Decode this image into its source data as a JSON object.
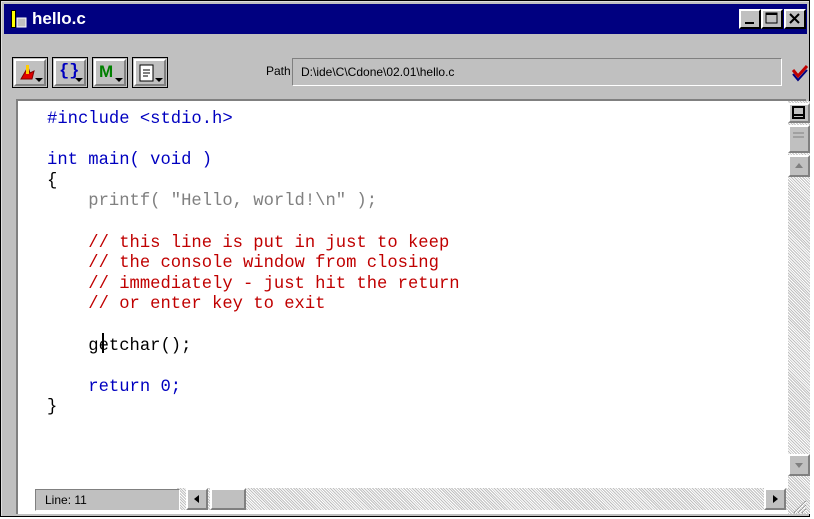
{
  "window": {
    "title": "hello.c"
  },
  "toolbar": {
    "buttons": [
      {
        "icon": "tools-icon",
        "label": ""
      },
      {
        "icon": "braces-icon",
        "label": "{}"
      },
      {
        "icon": "macro-icon",
        "label": "M"
      },
      {
        "icon": "document-icon",
        "label": ""
      }
    ],
    "path_label": "Path",
    "path_value": "D:\\ide\\C\\Cdone\\02.01\\hello.c"
  },
  "editor": {
    "lines": [
      "#include <stdio.h>",
      "",
      "int main( void )",
      "{",
      "    printf( \"Hello, world!\\n\" );",
      "",
      "    // this line is put in just to keep",
      "    // the console window from closing",
      "    // immediately - just hit the return",
      "    // or enter key to exit",
      "",
      "    getchar();",
      "",
      "    return 0;",
      "}"
    ]
  },
  "status": {
    "line_label": "Line: 11"
  },
  "colors": {
    "titlebar": "#000080",
    "keyword": "#0000c0",
    "comment": "#c00000",
    "string": "#808080",
    "face": "#c0c0c0"
  }
}
